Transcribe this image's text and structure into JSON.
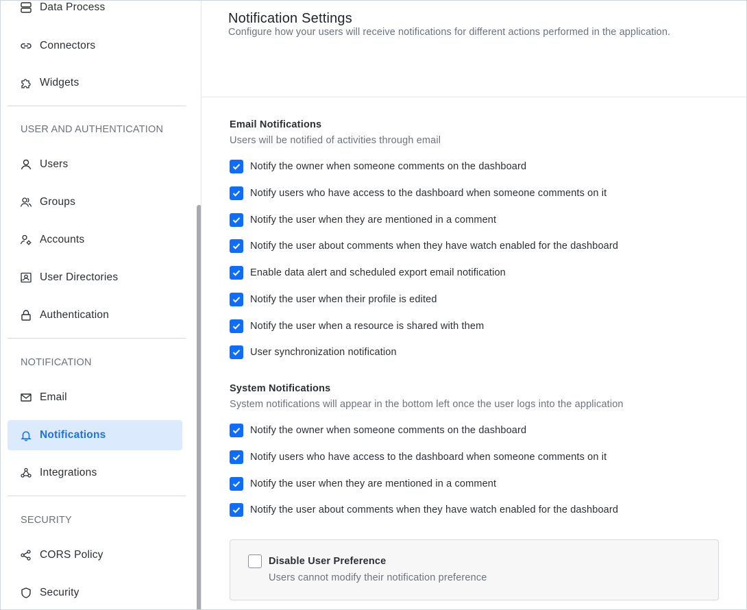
{
  "sidebar": {
    "items_top": [
      {
        "label": "Data Process",
        "icon": "data-process-icon"
      },
      {
        "label": "Connectors",
        "icon": "link-icon"
      },
      {
        "label": "Widgets",
        "icon": "puzzle-icon"
      }
    ],
    "sections": [
      {
        "title": "USER AND AUTHENTICATION",
        "items": [
          {
            "label": "Users",
            "icon": "user-icon"
          },
          {
            "label": "Groups",
            "icon": "group-icon"
          },
          {
            "label": "Accounts",
            "icon": "account-gear-icon"
          },
          {
            "label": "User Directories",
            "icon": "directory-icon"
          },
          {
            "label": "Authentication",
            "icon": "lock-icon"
          }
        ]
      },
      {
        "title": "NOTIFICATION",
        "items": [
          {
            "label": "Email",
            "icon": "mail-icon"
          },
          {
            "label": "Notifications",
            "icon": "bell-icon",
            "active": true
          },
          {
            "label": "Integrations",
            "icon": "webhook-icon"
          }
        ]
      },
      {
        "title": "SECURITY",
        "items": [
          {
            "label": "CORS Policy",
            "icon": "share-nodes-icon"
          },
          {
            "label": "Security",
            "icon": "shield-icon"
          }
        ]
      }
    ]
  },
  "page": {
    "title": "Notification Settings",
    "subtitle": "Configure how your users will receive notifications for different actions performed in the application."
  },
  "email": {
    "title": "Email Notifications",
    "description": "Users will be notified of activities through email",
    "options": [
      {
        "label": "Notify the owner when someone comments on the dashboard",
        "checked": true
      },
      {
        "label": "Notify users who have access to the dashboard when someone comments on it",
        "checked": true
      },
      {
        "label": "Notify the user when they are mentioned in a comment",
        "checked": true
      },
      {
        "label": "Notify the user about comments when they have watch enabled for the dashboard",
        "checked": true
      },
      {
        "label": "Enable data alert and scheduled export email notification",
        "checked": true
      },
      {
        "label": "Notify the user when their profile is edited",
        "checked": true
      },
      {
        "label": "Notify the user when a resource is shared with them",
        "checked": true
      },
      {
        "label": "User synchronization notification",
        "checked": true
      }
    ]
  },
  "system": {
    "title": "System Notifications",
    "description": "System notifications will appear in the bottom left once the user logs into the application",
    "options": [
      {
        "label": "Notify the owner when someone comments on the dashboard",
        "checked": true
      },
      {
        "label": "Notify users who have access to the dashboard when someone comments on it",
        "checked": true
      },
      {
        "label": "Notify the user when they are mentioned in a comment",
        "checked": true
      },
      {
        "label": "Notify the user about comments when they have watch enabled for the dashboard",
        "checked": true
      }
    ]
  },
  "preference": {
    "title": "Disable User Preference",
    "description": "Users cannot modify their notification preference",
    "checked": false
  },
  "colors": {
    "accent": "#0d6efd",
    "active_bg": "#dceafe",
    "active_text": "#1a73e8"
  }
}
